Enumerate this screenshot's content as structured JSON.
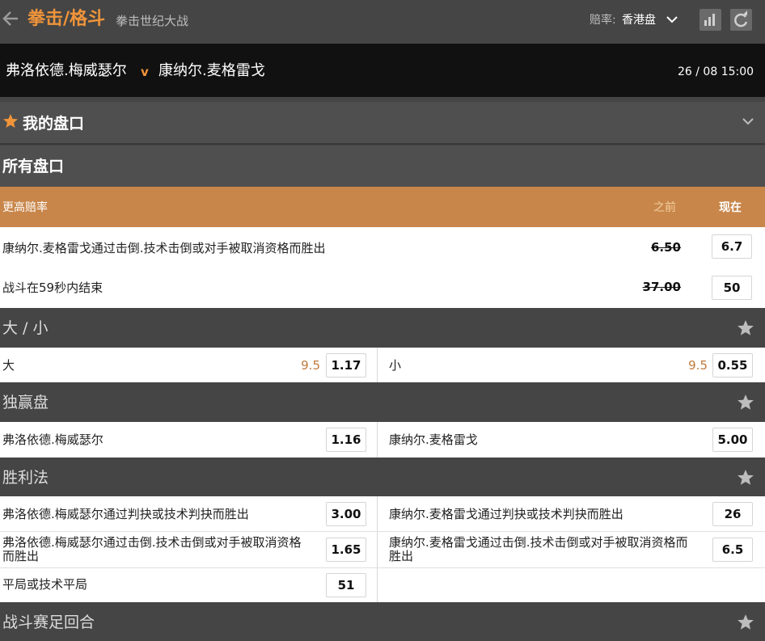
{
  "header": {
    "back_icon": "arrow-left-icon",
    "sport_title": "拳击/格斗",
    "event_subtitle": "拳击世纪大战",
    "odds_format_label": "赔率:",
    "odds_format_value": "香港盘",
    "stats_icon": "bar-chart-icon",
    "refresh_icon": "refresh-icon"
  },
  "match": {
    "home": "弗洛依德.梅威瑟尔",
    "vs": "v",
    "away": "康纳尔.麦格雷戈",
    "datetime": "26 / 08   15:00"
  },
  "my_markets": {
    "label": "我的盘口"
  },
  "all_markets": {
    "label": "所有盘口"
  },
  "higher_odds": {
    "title": "更高赔率",
    "col_before": "之前",
    "col_now": "现在",
    "rows": [
      {
        "selection": "康纳尔.麦格雷戈通过击倒.技术击倒或对手被取消资格而胜出",
        "before": "6.50",
        "now": "6.7"
      },
      {
        "selection": "战斗在59秒内结束",
        "before": "37.00",
        "now": "50"
      }
    ]
  },
  "over_under": {
    "title": "大 / 小",
    "left": {
      "label": "大",
      "line": "9.5",
      "price": "1.17"
    },
    "right": {
      "label": "小",
      "line": "9.5",
      "price": "0.55"
    }
  },
  "moneyline": {
    "title": "独赢盘",
    "left": {
      "label": "弗洛依德.梅威瑟尔",
      "price": "1.16"
    },
    "right": {
      "label": "康纳尔.麦格雷戈",
      "price": "5.00"
    }
  },
  "method": {
    "title": "胜利法",
    "rows": [
      {
        "left_label": "弗洛依德.梅威瑟尔通过判抉或技术判抉而胜出",
        "left_price": "3.00",
        "right_label": "康纳尔.麦格雷戈通过判抉或技术判抉而胜出",
        "right_price": "26"
      },
      {
        "left_label": "弗洛依德.梅威瑟尔通过击倒.技术击倒或对手被取消资格而胜出",
        "left_price": "1.65",
        "right_label": "康纳尔.麦格雷戈通过击倒.技术击倒或对手被取消资格而胜出",
        "right_price": "6.5"
      },
      {
        "left_label": "平局或技术平局",
        "left_price": "51"
      }
    ]
  },
  "rounds": {
    "title": "战斗赛足回合"
  },
  "colors": {
    "accent": "#f0943a",
    "higher_odds_band": "#c8864a",
    "section_bg": "#454545"
  }
}
